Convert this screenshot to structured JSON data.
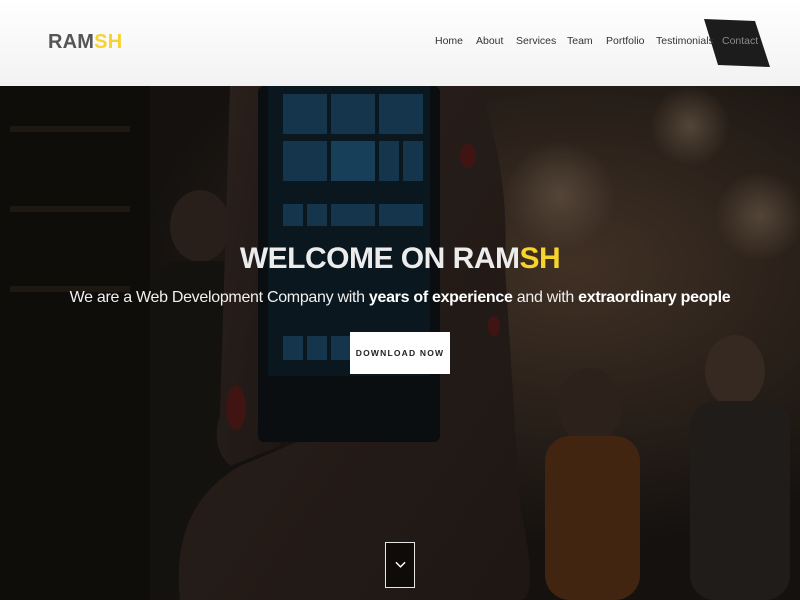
{
  "brand": {
    "part1": "RAM",
    "part2": "SH",
    "primary_color": "#555555",
    "accent_color": "#f6d32d"
  },
  "nav": {
    "items": [
      {
        "label": "Home"
      },
      {
        "label": "About"
      },
      {
        "label": "Services"
      },
      {
        "label": "Team"
      },
      {
        "label": "Portfolio"
      },
      {
        "label": "Testimonials"
      },
      {
        "label": "Contact",
        "active": true
      }
    ]
  },
  "hero": {
    "headline_prefix": "WELCOME ON",
    "headline_brand_1": "RAM",
    "headline_brand_2": "SH",
    "tagline_1": "We are a Web Development Company with",
    "tagline_bold_1": "years of experience",
    "tagline_2": "and with",
    "tagline_bold_2": "extraordinary people",
    "download_label": "DOWNLOAD NOW",
    "scroll_icon": "chevron-down-icon"
  }
}
